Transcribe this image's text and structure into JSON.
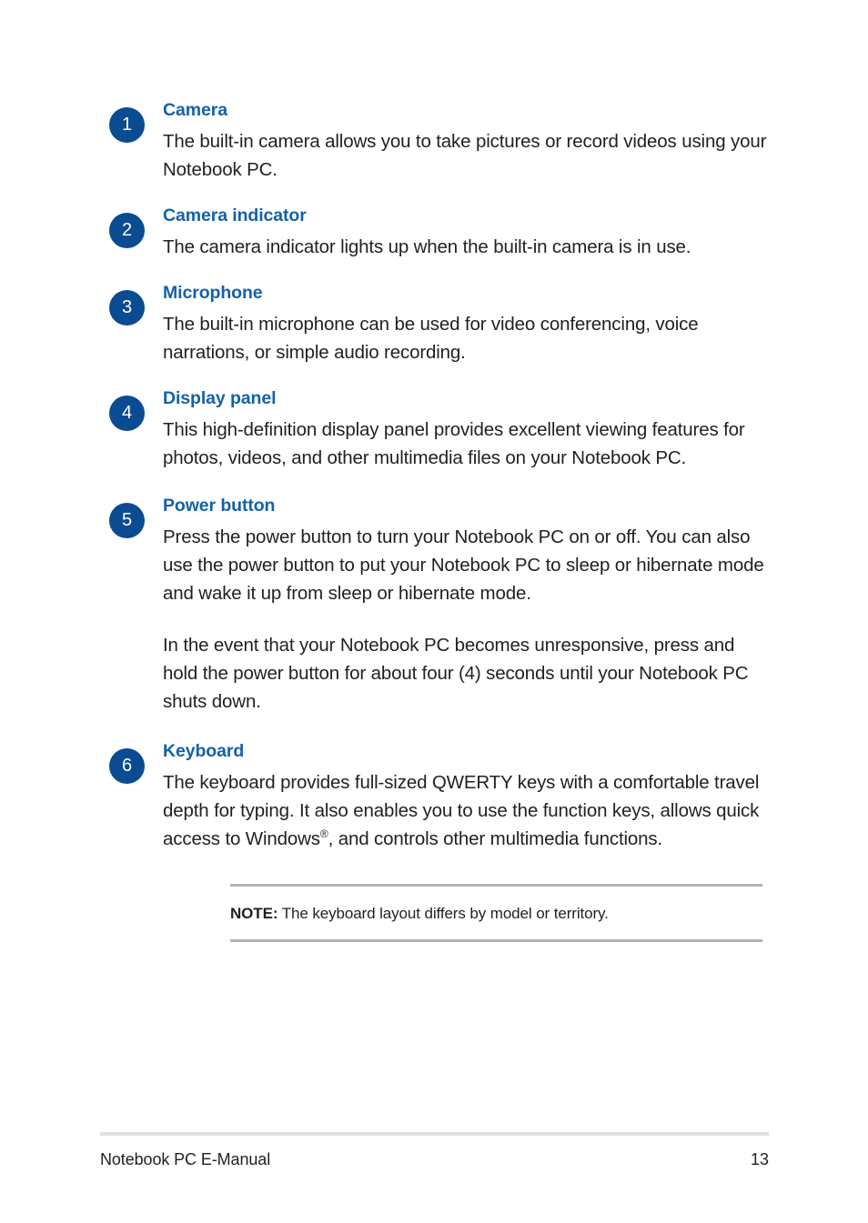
{
  "document": {
    "title": "Notebook PC E-Manual",
    "page_number": "13",
    "accent_blue": "#1461a9",
    "badge_blue": "#0b4b92",
    "text_color": "#231f20",
    "rule_color": "#b3b3b3",
    "footer_rule_color": "#e2e0e0"
  },
  "features": [
    {
      "number": "1",
      "title": "Camera",
      "paragraphs": [
        "The built-in camera allows you to take pictures or record videos using your Notebook PC."
      ]
    },
    {
      "number": "2",
      "title": "Camera indicator",
      "paragraphs": [
        "The camera indicator lights up when the built-in camera is in use."
      ]
    },
    {
      "number": "3",
      "title": "Microphone",
      "paragraphs": [
        "The built-in microphone can be used for video conferencing, voice narrations, or simple audio recording."
      ]
    },
    {
      "number": "4",
      "title": "Display panel",
      "paragraphs": [
        "This high-definition display panel provides excellent viewing features for photos, videos, and other multimedia files on your Notebook PC."
      ]
    },
    {
      "number": "5",
      "title": "Power button",
      "paragraphs": [
        "Press the power button to turn your Notebook PC on or off. You can also use the power button to put your Notebook PC to sleep or hibernate mode and wake it up from sleep or hibernate mode.",
        "In the event that your Notebook PC becomes unresponsive, press and hold the power button for about four (4) seconds until your Notebook PC shuts down."
      ]
    },
    {
      "number": "6",
      "title": "Keyboard",
      "paragraphs_rich": {
        "part1": "The keyboard provides full-sized QWERTY keys with a comfortable travel depth for typing. It also enables you to use the function keys, allows quick access to Windows",
        "superscript": "®",
        "part2": ", and controls other multimedia functions."
      }
    }
  ],
  "note": {
    "label": "NOTE:",
    "text": "The keyboard layout differs by model or territory."
  },
  "footer": {
    "label": "Notebook PC E-Manual",
    "page": "13"
  }
}
